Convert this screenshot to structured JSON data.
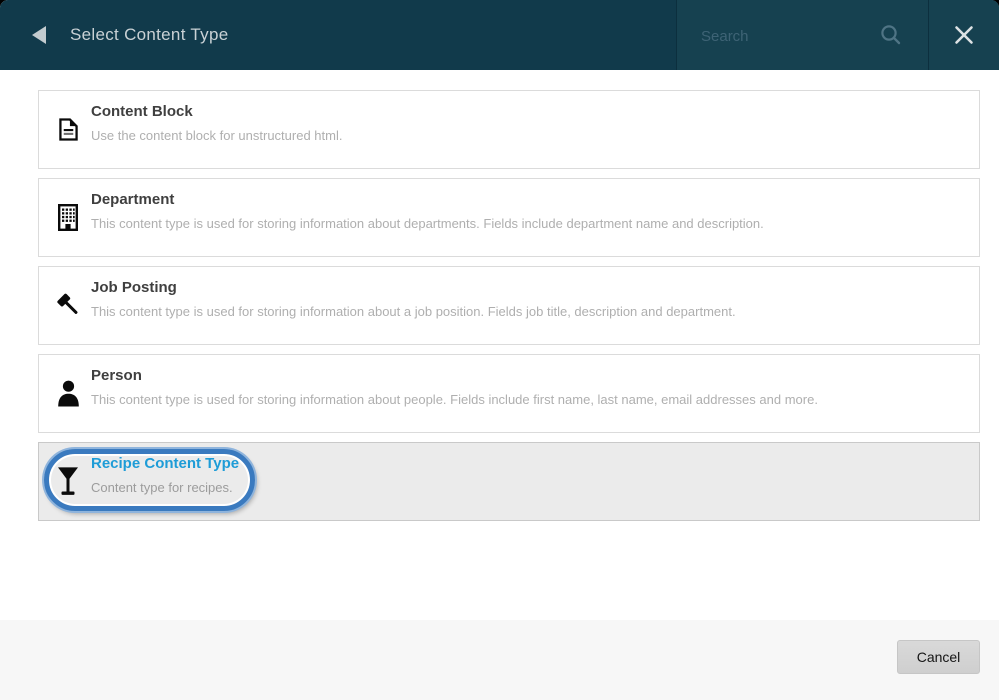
{
  "header": {
    "title": "Select Content Type",
    "back_icon": "back-arrow",
    "close_icon": "close-x",
    "search": {
      "placeholder": "Search",
      "icon": "magnifier"
    }
  },
  "content_types": [
    {
      "title": "Content Block",
      "description": "Use the content block for unstructured html.",
      "icon": "document-icon",
      "selected": false
    },
    {
      "title": "Department",
      "description": "This content type is used for storing information about departments. Fields include department name and description.",
      "icon": "building-icon",
      "selected": false
    },
    {
      "title": "Job Posting",
      "description": "This content type is used for storing information about a job position. Fields job title, description and department.",
      "icon": "gavel-icon",
      "selected": false
    },
    {
      "title": "Person",
      "description": "This content type is used for storing information about people. Fields include first name, last name, email addresses and more.",
      "icon": "person-icon",
      "selected": false
    },
    {
      "title": "Recipe Content Type",
      "description": "Content type for recipes.",
      "icon": "martini-glass-icon",
      "selected": true,
      "annotated": true
    }
  ],
  "annotation": {
    "shape": "oval",
    "color": "#3A7ABF",
    "target": "Recipe Content Type"
  },
  "footer": {
    "cancel_label": "Cancel"
  },
  "colors": {
    "header_teal": "#113A4B",
    "header_panel": "#164150",
    "accent_blue": "#1E9CD7",
    "annotation_blue": "#3A7ABF",
    "selected_row_bg": "#EBEBEB"
  }
}
